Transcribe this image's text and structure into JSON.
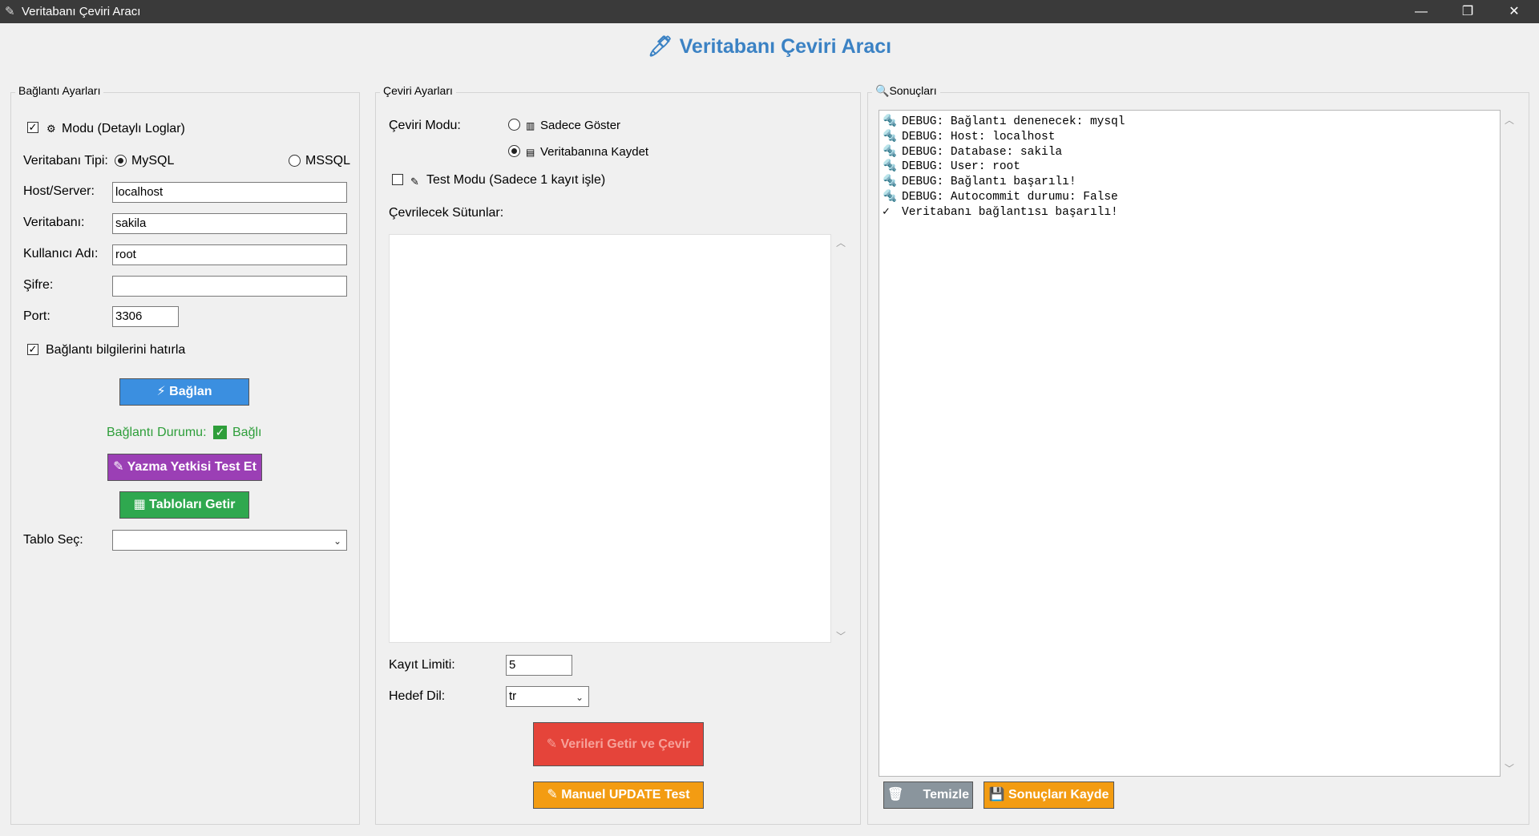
{
  "window": {
    "title": "Veritabanı Çeviri Aracı",
    "controls": {
      "minimize": "—",
      "maximize": "❐",
      "close": "✕"
    }
  },
  "header": {
    "title": "Veritabanı Çeviri Aracı",
    "icon": "pencil-icon"
  },
  "connection": {
    "group_label": "Bağlantı Ayarları",
    "debug_mode_label": "Modu (Detaylı Loglar)",
    "debug_mode_checked": true,
    "db_type_label": "Veritabanı Tipi:",
    "db_type_mysql": "MySQL",
    "db_type_mssql": "MSSQL",
    "db_type_selected": "MySQL",
    "host_label": "Host/Server:",
    "host_value": "localhost",
    "db_label": "Veritabanı:",
    "db_value": "sakila",
    "user_label": "Kullanıcı Adı:",
    "user_value": "root",
    "password_label": "Şifre:",
    "password_value": "",
    "port_label": "Port:",
    "port_value": "3306",
    "remember_label": "Bağlantı bilgilerini hatırla",
    "remember_checked": true,
    "connect_button": "Bağlan",
    "status_label": "Bağlantı Durumu:",
    "status_value": "Bağlı",
    "write_test_button": "Yazma Yetkisi Test Et",
    "fetch_tables_button": "Tabloları Getir",
    "table_select_label": "Tablo Seç:",
    "table_select_value": ""
  },
  "translation": {
    "group_label": "Çeviri Ayarları",
    "mode_label": "Çeviri Modu:",
    "mode_show": "Sadece Göster",
    "mode_save": "Veritabanına Kaydet",
    "mode_selected": "Veritabanına Kaydet",
    "test_mode_label": "Test Modu (Sadece 1 kayıt işle)",
    "test_mode_checked": false,
    "columns_label": "Çevrilecek Sütunlar:",
    "limit_label": "Kayıt Limiti:",
    "limit_value": "5",
    "target_lang_label": "Hedef Dil:",
    "target_lang_value": "tr",
    "fetch_translate_button": "Verileri Getir ve Çevir",
    "manual_update_button": "Manuel UPDATE Test"
  },
  "results": {
    "group_label": "Sonuçları",
    "lines": [
      {
        "icon": "🔩",
        "text": "DEBUG: Bağlantı denenecek: mysql"
      },
      {
        "icon": "🔩",
        "text": "DEBUG: Host: localhost"
      },
      {
        "icon": "🔩",
        "text": "DEBUG: Database: sakila"
      },
      {
        "icon": "🔩",
        "text": "DEBUG: User: root"
      },
      {
        "icon": "🔩",
        "text": "DEBUG: Bağlantı başarılı!"
      },
      {
        "icon": "🔩",
        "text": "DEBUG: Autocommit durumu: False"
      },
      {
        "icon": "✓",
        "text": "Veritabanı bağlantısı başarılı!"
      }
    ],
    "clear_button": "Temizle",
    "save_button": "Sonuçları Kayde"
  },
  "colors": {
    "header": "#3b82c4",
    "status_green": "#2e9e3a",
    "connect_blue": "#3b8fe0",
    "write_purple": "#9b3fb5",
    "tables_green": "#2fa84f",
    "translate_red": "#e5443a",
    "update_orange": "#f39c12",
    "clear_gray": "#8a959d"
  }
}
